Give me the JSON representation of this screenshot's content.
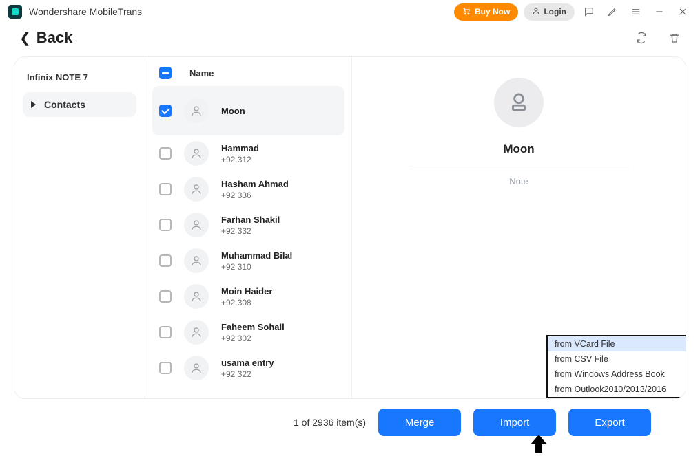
{
  "app_title": "Wondershare MobileTrans",
  "titlebar": {
    "buy_now": "Buy Now",
    "login": "Login"
  },
  "back_label": "Back",
  "sidebar": {
    "device": "Infinix NOTE 7",
    "contacts_label": "Contacts"
  },
  "header": {
    "name": "Name"
  },
  "contacts": [
    {
      "name": "Moon",
      "phone": "",
      "selected": true
    },
    {
      "name": "Hammad",
      "phone": "+92 312",
      "selected": false
    },
    {
      "name": "Hasham  Ahmad",
      "phone": "+92 336",
      "selected": false
    },
    {
      "name": "Farhan  Shakil",
      "phone": "+92 332",
      "selected": false
    },
    {
      "name": "Muhammad  Bilal",
      "phone": "+92 310",
      "selected": false
    },
    {
      "name": "Moin  Haider",
      "phone": "+92 308",
      "selected": false
    },
    {
      "name": "Faheem  Sohail",
      "phone": "+92 302",
      "selected": false
    },
    {
      "name": "usama  entry",
      "phone": "+92 322",
      "selected": false
    }
  ],
  "detail": {
    "name": "Moon",
    "note_label": "Note"
  },
  "import_menu": {
    "items": [
      "from VCard File",
      "from CSV File",
      "from Windows Address  Book",
      "from Outlook2010/2013/2016"
    ]
  },
  "footer": {
    "count_text": "1  of  2936  item(s)",
    "merge": "Merge",
    "import": "Import",
    "export": "Export"
  }
}
